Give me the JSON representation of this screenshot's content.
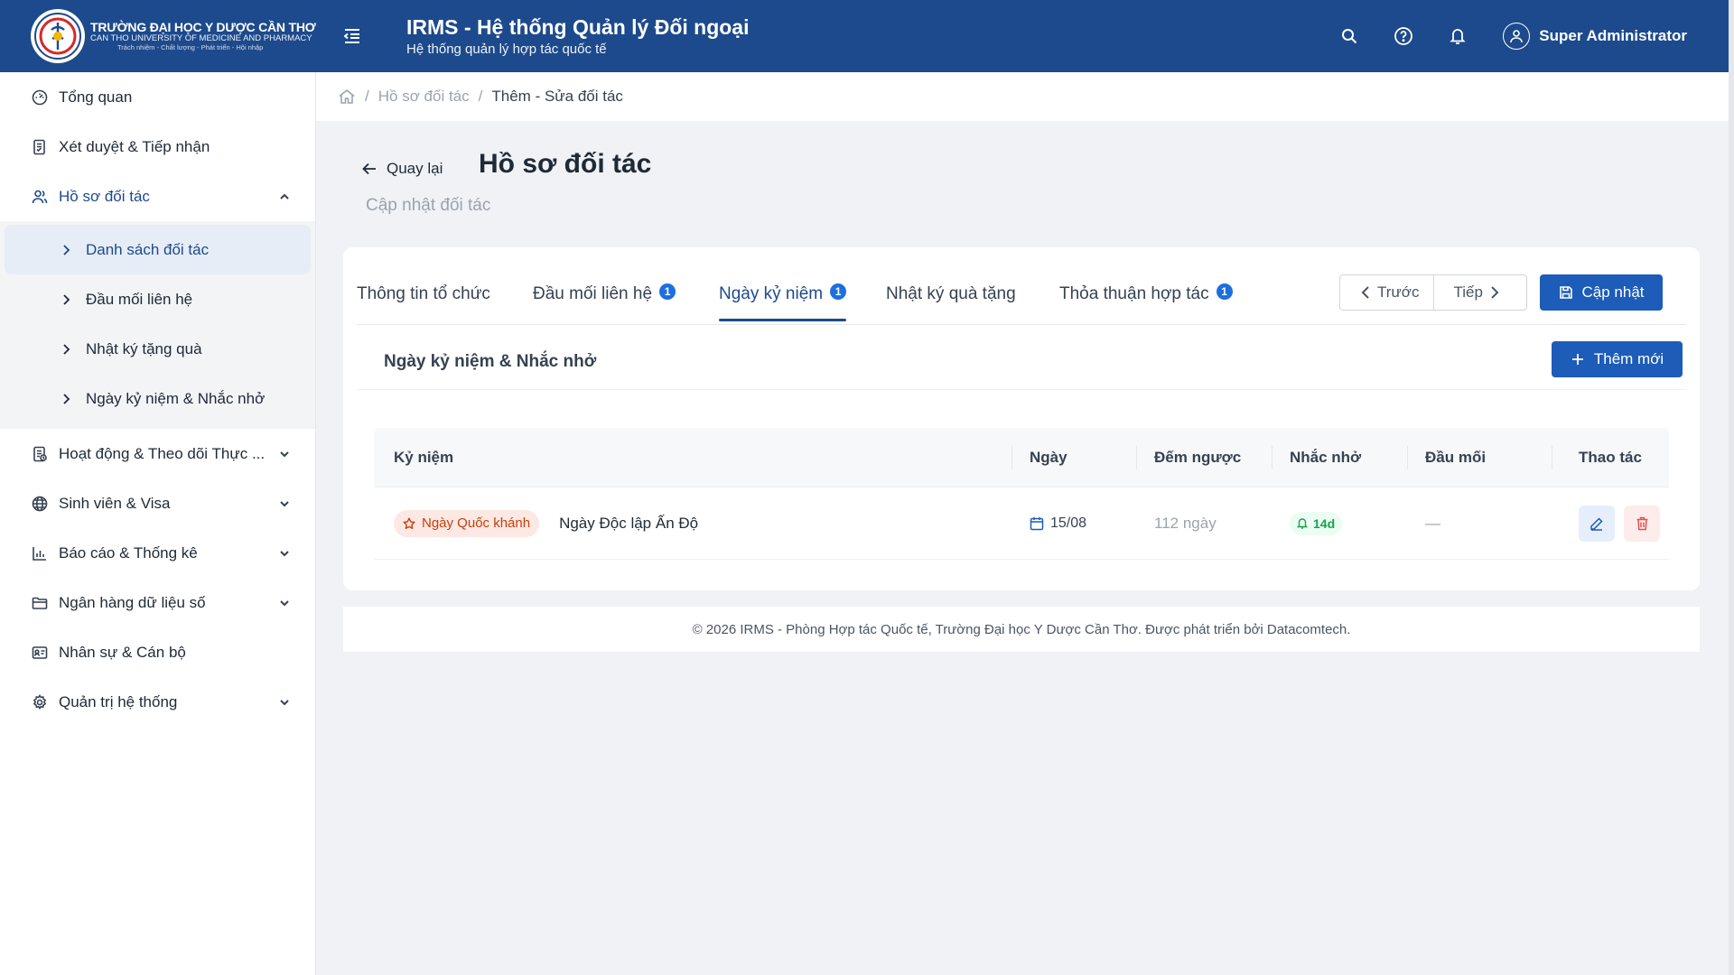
{
  "brand": {
    "name": "TRƯỜNG ĐẠI HỌC Y DƯỢC CẦN THƠ",
    "name_en": "CAN THO UNIVERSITY OF MEDICINE AND PHARMACY",
    "motto": "Trách nhiệm - Chất lượng - Phát triển - Hội nhập"
  },
  "header": {
    "title": "IRMS - Hệ thống Quản lý Đối ngoại",
    "subtitle": "Hệ thống quản lý hợp tác quốc tế",
    "user_name": "Super Administrator"
  },
  "sidebar": {
    "items": [
      {
        "label": "Tổng quan",
        "icon": "dashboard-icon"
      },
      {
        "label": "Xét duyệt & Tiếp nhận",
        "icon": "approval-icon"
      },
      {
        "label": "Hồ sơ đối tác",
        "icon": "partners-icon",
        "expanded": true
      },
      {
        "label": "Hoạt động & Theo dõi Thực ...",
        "icon": "activity-icon"
      },
      {
        "label": "Sinh viên & Visa",
        "icon": "globe-icon"
      },
      {
        "label": "Báo cáo & Thống kê",
        "icon": "chart-icon"
      },
      {
        "label": "Ngân hàng dữ liệu số",
        "icon": "folder-icon"
      },
      {
        "label": "Nhân sự & Cán bộ",
        "icon": "id-card-icon"
      },
      {
        "label": "Quản trị hệ thống",
        "icon": "gear-icon"
      }
    ],
    "submenu": [
      {
        "label": "Danh sách đối tác",
        "active": true
      },
      {
        "label": "Đầu mối liên hệ"
      },
      {
        "label": "Nhật ký tặng quà"
      },
      {
        "label": "Ngày kỷ niệm & Nhắc nhở"
      }
    ]
  },
  "breadcrumb": {
    "items": [
      "Hồ sơ đối tác",
      "Thêm - Sửa đối tác"
    ]
  },
  "page": {
    "back_label": "Quay lại",
    "title": "Hồ sơ đối tác",
    "subtitle": "Cập nhật đối tác"
  },
  "tabs": [
    {
      "label": "Thông tin tổ chức",
      "badge": ""
    },
    {
      "label": "Đầu mối liên hệ",
      "badge": "1"
    },
    {
      "label": "Ngày kỷ niệm",
      "badge": "1",
      "active": true
    },
    {
      "label": "Nhật ký quà tặng",
      "badge": ""
    },
    {
      "label": "Thỏa thuận hợp tác",
      "badge": "1"
    }
  ],
  "pager": {
    "prev": "Trước",
    "next": "Tiếp"
  },
  "update_button": "Cập nhật",
  "section": {
    "title": "Ngày kỷ niệm & Nhắc nhở",
    "add_button": "Thêm mới"
  },
  "table": {
    "columns": [
      "Kỷ niệm",
      "Ngày",
      "Đếm ngược",
      "Nhắc nhở",
      "Đầu mối",
      "Thao tác"
    ],
    "rows": [
      {
        "tag": "Ngày Quốc khánh",
        "name": "Ngày Độc lập Ấn Độ",
        "date": "15/08",
        "countdown": "112 ngày",
        "reminder": "14d",
        "contact": "—"
      }
    ]
  },
  "footer": {
    "text": "© 2026 IRMS - Phòng Hợp tác Quốc tế, Trường Đại học Y Dược Cần Thơ. Được phát triển bởi Datacomtech."
  },
  "colors": {
    "primary": "#1d4a8c",
    "button": "#1d5cb8",
    "badge": "#1d6fe0",
    "tag_national_bg": "#fde8e4",
    "tag_national_fg": "#c2410c",
    "reminder_fg": "#16a34a"
  }
}
